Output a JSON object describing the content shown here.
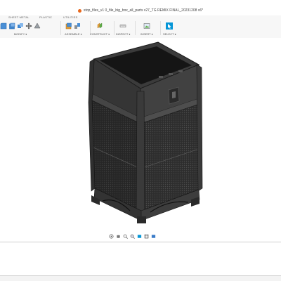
{
  "window": {
    "title": "stop_files_v1 0_file_big_box_all_parts v27_TG REMIX FINAL_20231208 v6*"
  },
  "ribbon": {
    "tabs": [
      "SHEET METAL",
      "PLASTIC",
      "UTILITIES"
    ],
    "groups": {
      "modify": "MODIFY ▾",
      "assemble": "ASSEMBLE ▾",
      "construct": "CONSTRUCT ▾",
      "inspect": "INSPECT ▾",
      "insert": "INSERT ▾",
      "select": "SELECT ▾"
    }
  },
  "colors": {
    "accent": "#0696d7",
    "tab_dot": "#e8681c",
    "model_dark": "#2b2b2b",
    "model_mid": "#3a3a3a"
  },
  "icons": {
    "modify": [
      "fillet-icon",
      "shell-icon",
      "combine-icon",
      "move-icon",
      "appearance-icon"
    ],
    "assemble": [
      "new-component-icon",
      "joint-icon"
    ],
    "construct": "offset-plane-icon",
    "inspect": "measure-icon",
    "insert": "insert-image-icon",
    "select": "select-arrow-icon",
    "nav": [
      "orbit-icon",
      "pan-icon",
      "zoom-icon",
      "fit-icon",
      "display-settings-icon",
      "grid-icon",
      "viewports-icon"
    ]
  }
}
